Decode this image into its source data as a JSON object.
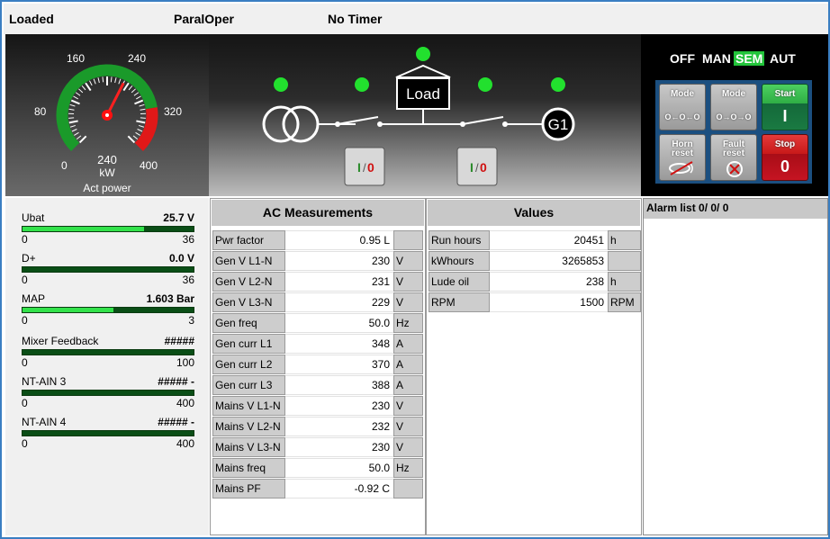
{
  "status": {
    "state": "Loaded",
    "mode": "ParalOper",
    "timer": "No Timer"
  },
  "gauge": {
    "scale_labels": [
      "0",
      "80",
      "160",
      "240",
      "320",
      "400"
    ],
    "value": "240",
    "value_num": 240,
    "max": 400,
    "unit": "kW",
    "title": "Act power"
  },
  "diagram": {
    "load_label": "Load",
    "generator_label": "G1",
    "breaker_labels": [
      {
        "on": "I",
        "off": "0"
      },
      {
        "on": "I",
        "off": "0"
      }
    ]
  },
  "modes": {
    "items": [
      "OFF",
      "MAN",
      "SEM",
      "AUT"
    ],
    "active": "SEM"
  },
  "buttons": {
    "mode_left": "Mode",
    "mode_right": "Mode",
    "start": "Start",
    "start_symbol": "I",
    "horn_reset_1": "Horn",
    "horn_reset_2": "reset",
    "fault_reset_1": "Fault",
    "fault_reset_2": "reset",
    "stop": "Stop",
    "stop_symbol": "0"
  },
  "left_meters": [
    {
      "name": "Ubat",
      "value": "25.7 V",
      "min": "0",
      "max": "36",
      "fill": 0.71
    },
    {
      "name": "D+",
      "value": "0.0 V",
      "min": "0",
      "max": "36",
      "fill": 0.0
    },
    {
      "name": "MAP",
      "value": "1.603 Bar",
      "min": "0",
      "max": "3",
      "fill": 0.53
    },
    {
      "name": "Mixer Feedback",
      "value": "#####",
      "min": "0",
      "max": "100",
      "fill": 0.0
    },
    {
      "name": "NT-AIN 3",
      "value": "##### -",
      "min": "0",
      "max": "400",
      "fill": 0.0
    },
    {
      "name": "NT-AIN 4",
      "value": "##### -",
      "min": "0",
      "max": "400",
      "fill": 0.0
    }
  ],
  "ac": {
    "title": "AC Measurements",
    "rows": [
      {
        "name": "Pwr factor",
        "value": "0.95 L",
        "unit": ""
      },
      {
        "name": "Gen V L1-N",
        "value": "230",
        "unit": "V"
      },
      {
        "name": "Gen V L2-N",
        "value": "231",
        "unit": "V"
      },
      {
        "name": "Gen V L3-N",
        "value": "229",
        "unit": "V"
      },
      {
        "name": "Gen freq",
        "value": "50.0",
        "unit": "Hz"
      },
      {
        "name": "Gen curr L1",
        "value": "348",
        "unit": "A"
      },
      {
        "name": "Gen curr L2",
        "value": "370",
        "unit": "A"
      },
      {
        "name": "Gen curr L3",
        "value": "388",
        "unit": "A"
      },
      {
        "name": "Mains V L1-N",
        "value": "230",
        "unit": "V"
      },
      {
        "name": "Mains V L2-N",
        "value": "232",
        "unit": "V"
      },
      {
        "name": "Mains V L3-N",
        "value": "230",
        "unit": "V"
      },
      {
        "name": "Mains freq",
        "value": "50.0",
        "unit": "Hz"
      },
      {
        "name": "Mains PF",
        "value": "-0.92 C",
        "unit": ""
      }
    ]
  },
  "values": {
    "title": "Values",
    "rows": [
      {
        "name": "Run hours",
        "value": "20451",
        "unit": "h"
      },
      {
        "name": "kWhours",
        "value": "3265853",
        "unit": ""
      },
      {
        "name": "Lude oil",
        "value": "238",
        "unit": "h"
      },
      {
        "name": "RPM",
        "value": "1500",
        "unit": "RPM"
      }
    ]
  },
  "alarm": {
    "title": "Alarm list  0/ 0/ 0"
  },
  "colors": {
    "indicator_green": "#22e02e",
    "active_mode": "#22c43a",
    "gauge_green": "#1a9a2a",
    "gauge_red": "#e01818"
  }
}
